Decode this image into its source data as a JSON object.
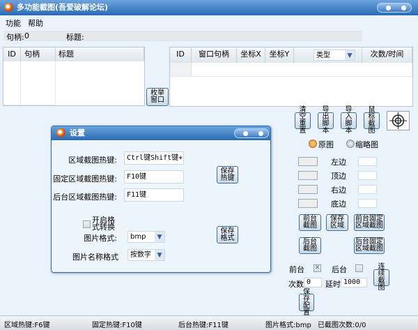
{
  "window": {
    "title": "多功能截图(吾爱破解论坛)",
    "accent": "#2a6bb5"
  },
  "menu": [
    "功能",
    "帮助"
  ],
  "info": {
    "handle_label": "句柄:",
    "handle_value": "0",
    "title_label": "标题:"
  },
  "left_table": {
    "columns": [
      "ID",
      "句柄",
      "标题"
    ]
  },
  "enum_button": "枚举窗口",
  "right_table": {
    "columns": [
      "ID",
      "窗口句柄",
      "坐标X",
      "坐标Y",
      "类型",
      "次数/时间"
    ],
    "type_select": "类型"
  },
  "tools": {
    "clear": "清空重置",
    "export": "导出脚本",
    "import": "导入脚本",
    "mouse": "鼠标截图",
    "crosshair_icon": "crosshair-icon"
  },
  "radios": {
    "original": "原图",
    "thumbnail": "缩略图",
    "selected": "original"
  },
  "edges": [
    "左边",
    "顶边",
    "右边",
    "底边"
  ],
  "buttons": {
    "front_capture": "前台截图",
    "save_region": "保存区域",
    "front_fixed": "前台固定区域截图",
    "back_capture": "后台截图",
    "back_fixed": "后台固定区域截图",
    "continuous": "连续截图",
    "save_config": "保存配置"
  },
  "mode": {
    "front": "前台",
    "front_checked": true,
    "back": "后台",
    "back_checked": false
  },
  "count": {
    "label": "次数",
    "value": "0"
  },
  "delay": {
    "label": "延时",
    "value": "1000"
  },
  "dialog": {
    "title": "设置",
    "region_hotkey_label": "区域截图热键:",
    "region_hotkey": "Ctrl键Shift键+Shi",
    "fixed_hotkey_label": "固定区域截图热键:",
    "fixed_hotkey": "F10键",
    "back_hotkey_label": "后台区域截图热键:",
    "back_hotkey": "F11键",
    "save_hotkey": "保存热键",
    "format_convert": "开启格式转换",
    "format_convert_checked": false,
    "image_format_label": "图片格式:",
    "image_format": "bmp",
    "name_format_label": "图片名称格式",
    "name_format": "按数字",
    "save_format": "保存格式"
  },
  "status": [
    "区域热键:F6键",
    "固定热键:F10键",
    "后台热键:F11键",
    "图片格式:bmp",
    "已截图次数:0/0"
  ]
}
